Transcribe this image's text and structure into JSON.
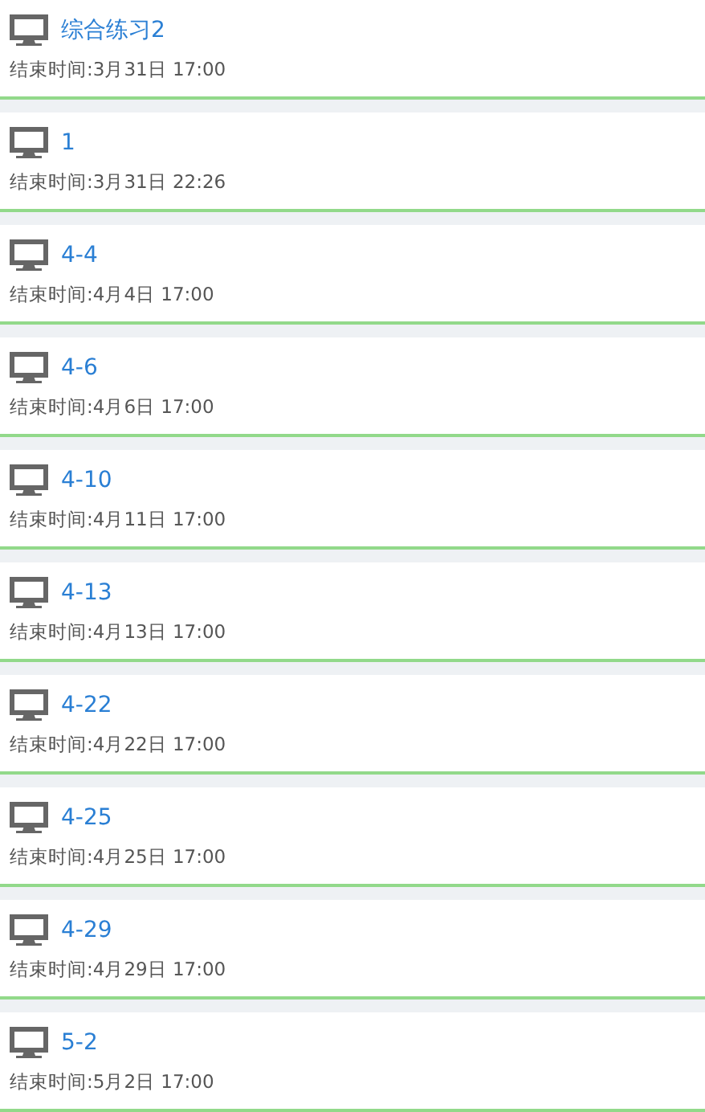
{
  "tasks": [
    {
      "title": "综合练习2",
      "end_time": "结束时间:3月31日 17:00"
    },
    {
      "title": "1",
      "end_time": "结束时间:3月31日 22:26"
    },
    {
      "title": "4-4",
      "end_time": "结束时间:4月4日 17:00"
    },
    {
      "title": "4-6",
      "end_time": "结束时间:4月6日 17:00"
    },
    {
      "title": "4-10",
      "end_time": "结束时间:4月11日 17:00"
    },
    {
      "title": "4-13",
      "end_time": "结束时间:4月13日 17:00"
    },
    {
      "title": "4-22",
      "end_time": "结束时间:4月22日 17:00"
    },
    {
      "title": "4-25",
      "end_time": "结束时间:4月25日 17:00"
    },
    {
      "title": "4-29",
      "end_time": "结束时间:4月29日 17:00"
    },
    {
      "title": "5-2",
      "end_time": "结束时间:5月2日 17:00"
    }
  ]
}
